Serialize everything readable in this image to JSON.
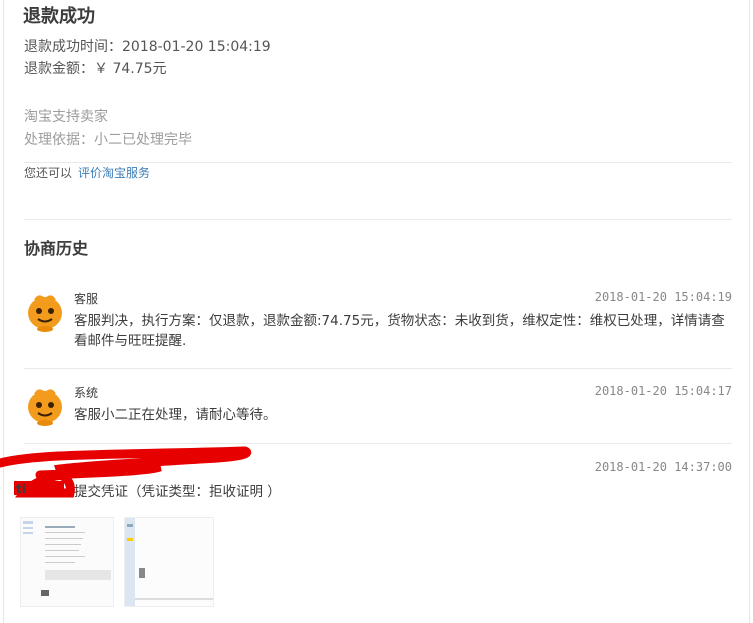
{
  "refund": {
    "status_title": "退款成功",
    "success_time": "退款成功时间：2018-01-20 15:04:19",
    "amount": "退款金额：￥ 74.75元",
    "support": "淘宝支持卖家",
    "basis": "处理依据：小二已处理完毕",
    "prompt": "您还可以",
    "rate_link": "评价淘宝服务"
  },
  "history": {
    "title": "协商历史",
    "entries": [
      {
        "who": "客服",
        "time": "2018-01-20 15:04:19",
        "message": "客服判决，执行方案：仅退款，退款金额:74.75元，货物状态：未收到货，维权定性：维权已处理，详情请查看邮件与旺旺提醒."
      },
      {
        "who": "系统",
        "time": "2018-01-20 15:04:17",
        "message": "客服小二正在处理，请耐心等待。"
      },
      {
        "who": "",
        "time": "2018-01-20 14:37:00",
        "message": "提交凭证（凭证类型：拒收证明 ）"
      }
    ]
  },
  "colors": {
    "link": "#3c7eb8",
    "avatar": "#f29b1d",
    "redaction": "#e60000"
  },
  "icons": [
    "mascot-avatar-icon",
    "evidence-image-thumbnail"
  ]
}
